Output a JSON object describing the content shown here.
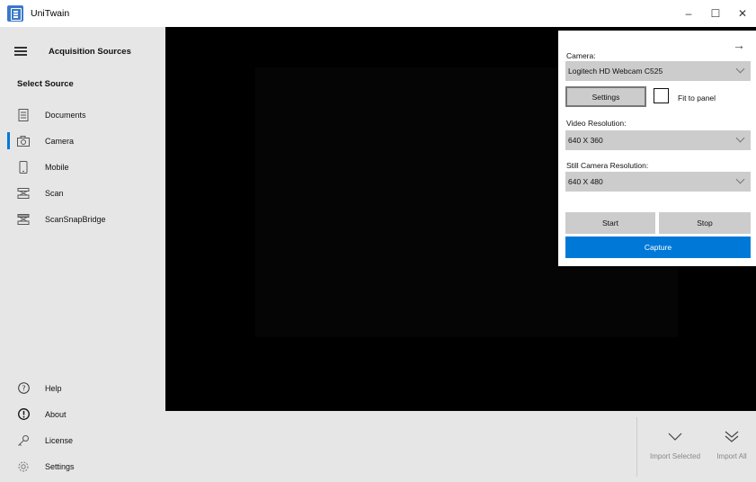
{
  "window": {
    "title": "UniTwain",
    "controls": {
      "minimize": "–",
      "maximize": "☐",
      "close": "✕"
    }
  },
  "sidebar": {
    "header": "Acquisition Sources",
    "section_title": "Select Source",
    "sources": [
      {
        "label": "Documents",
        "icon": "document-icon",
        "active": false
      },
      {
        "label": "Camera",
        "icon": "camera-icon",
        "active": true
      },
      {
        "label": "Mobile",
        "icon": "mobile-icon",
        "active": false
      },
      {
        "label": "Scan",
        "icon": "scanner-icon",
        "active": false
      },
      {
        "label": "ScanSnapBridge",
        "icon": "scansnap-icon",
        "active": false
      }
    ],
    "footer": [
      {
        "label": "Help",
        "icon": "help-icon"
      },
      {
        "label": "About",
        "icon": "info-icon"
      },
      {
        "label": "License",
        "icon": "key-icon"
      },
      {
        "label": "Settings",
        "icon": "gear-icon"
      }
    ]
  },
  "camera_panel": {
    "camera_label": "Camera:",
    "camera_value": "Logitech HD Webcam C525",
    "settings_button": "Settings",
    "fit_to_panel_label": "Fit to panel",
    "fit_to_panel_checked": false,
    "video_resolution_label": "Video Resolution:",
    "video_resolution_value": "640 X 360",
    "still_resolution_label": "Still Camera Resolution:",
    "still_resolution_value": "640 X 480",
    "start_button": "Start",
    "stop_button": "Stop",
    "capture_button": "Capture"
  },
  "bottom_bar": {
    "import_selected": "Import Selected",
    "import_all": "Import All"
  },
  "colors": {
    "accent": "#0078d7",
    "sidebar_bg": "#e6e6e6",
    "video_bg": "#000000",
    "control_bg": "#cccccc"
  }
}
